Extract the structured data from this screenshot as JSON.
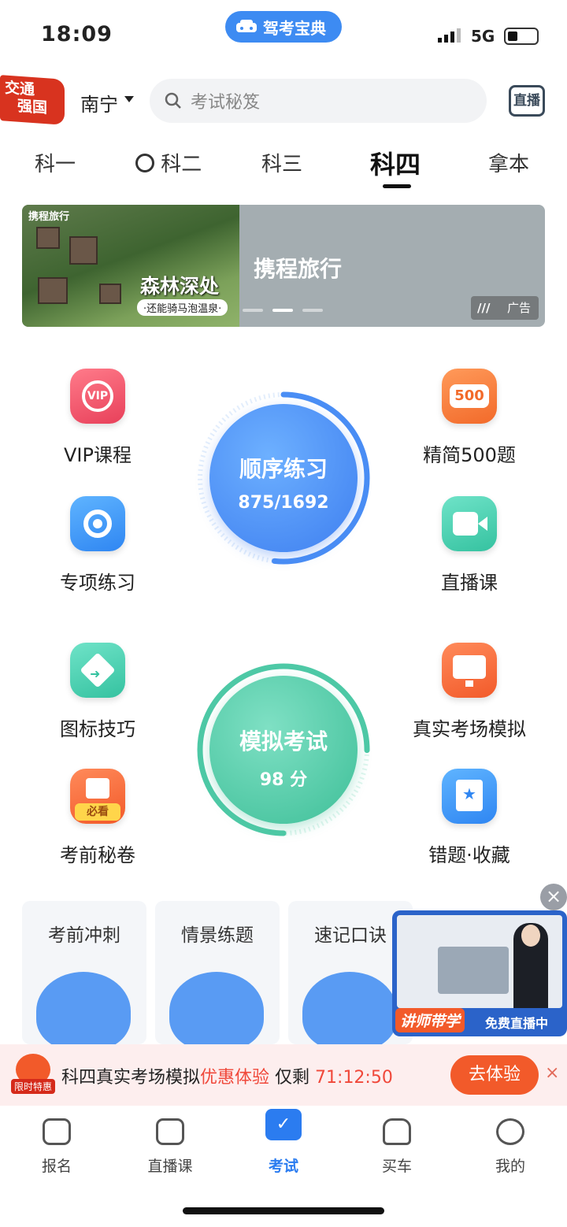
{
  "status_bar": {
    "time": "18:09",
    "app_pill": "驾考宝典",
    "network": "5G"
  },
  "header": {
    "badge_line1": "交通",
    "badge_line2": "强国",
    "city": "南宁",
    "search_placeholder": "考试秘笈",
    "live_label": "直播"
  },
  "tabs": [
    {
      "label": "科一",
      "active": false
    },
    {
      "label": "科二",
      "active": false
    },
    {
      "label": "科三",
      "active": false
    },
    {
      "label": "科四",
      "active": true
    },
    {
      "label": "拿本",
      "active": false
    }
  ],
  "banner": {
    "logo_text": "携程旅行",
    "slogan": "森林深处",
    "sub": "·还能骑马泡温泉·",
    "title": "携程旅行",
    "ad_label": "广告"
  },
  "features_left": [
    {
      "label": "VIP课程",
      "icon": "vip-icon"
    },
    {
      "label": "专项练习",
      "icon": "target-icon"
    },
    {
      "label": "图标技巧",
      "icon": "sign-icon"
    },
    {
      "label": "考前秘卷",
      "icon": "exam-paper-icon",
      "badge": "必看"
    }
  ],
  "features_right": [
    {
      "label": "精简500题",
      "icon": "500-icon",
      "badge": "500"
    },
    {
      "label": "直播课",
      "icon": "video-icon"
    },
    {
      "label": "真实考场模拟",
      "icon": "monitor-icon"
    },
    {
      "label": "错题·收藏",
      "icon": "bookmark-icon"
    }
  ],
  "practice_circle": {
    "title": "顺序练习",
    "progress_text": "875/1692",
    "done": 875,
    "total": 1692,
    "color": "#4a8ef5"
  },
  "exam_circle": {
    "title": "模拟考试",
    "score_text": "98 分",
    "color": "#4ec9a6"
  },
  "cards": [
    {
      "label": "考前冲刺"
    },
    {
      "label": "情景练题"
    },
    {
      "label": "速记口诀"
    }
  ],
  "video": {
    "tag_teacher": "讲师带学",
    "tag_free": "免费直播中"
  },
  "promo": {
    "limit_label": "限时特惠",
    "text_main": "科四真实考场模拟",
    "text_highlight": "优惠体验",
    "text_remain": " 仅剩 ",
    "countdown": "71:12:50",
    "button": "去体验"
  },
  "bottom_nav": [
    {
      "label": "报名",
      "active": false
    },
    {
      "label": "直播课",
      "active": false
    },
    {
      "label": "考试",
      "active": true
    },
    {
      "label": "买车",
      "active": false
    },
    {
      "label": "我的",
      "active": false
    }
  ]
}
